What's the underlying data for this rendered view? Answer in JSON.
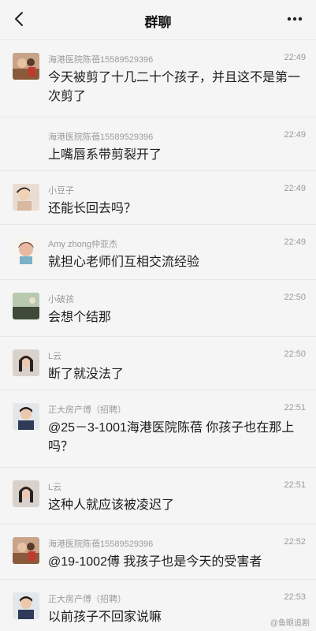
{
  "header": {
    "title": "群聊",
    "back_icon": "chevron-left-icon",
    "more_icon": "more-horizontal-icon"
  },
  "messages": [
    {
      "sender": "海港医院陈蓓15589529396",
      "time": "22:49",
      "text": "今天被剪了十几二十个孩子，并且这不是第一次剪了",
      "avatar": "group-photo-avatar"
    },
    {
      "sender": "海港医院陈蓓15589529396",
      "time": "22:49",
      "text": "上嘴唇系带剪裂开了",
      "avatar": "none"
    },
    {
      "sender": "小豆子",
      "time": "22:49",
      "text": "还能长回去吗？",
      "avatar": "child-photo-avatar"
    },
    {
      "sender": "Amy zhong仲亚杰",
      "time": "22:49",
      "text": "就担心老师们互相交流经验",
      "avatar": "cartoon-avatar"
    },
    {
      "sender": "小破孩",
      "time": "22:50",
      "text": "会想个结那",
      "avatar": "landscape-avatar"
    },
    {
      "sender": "L云",
      "time": "22:50",
      "text": "断了就没法了",
      "avatar": "portrait-avatar"
    },
    {
      "sender": "正大房产傅（招聘）",
      "time": "22:51",
      "text": "@25－3-1001海港医院陈蓓 你孩子也在那上吗？",
      "avatar": "man-photo-avatar"
    },
    {
      "sender": "L云",
      "time": "22:51",
      "text": "这种人就应该被凌迟了",
      "avatar": "portrait-avatar"
    },
    {
      "sender": "海港医院陈蓓15589529396",
      "time": "22:52",
      "text": "@19-1002傅 我孩子也是今天的受害者",
      "avatar": "group-photo-avatar"
    },
    {
      "sender": "正大房产傅（招聘）",
      "time": "22:53",
      "text": "以前孩子不回家说嘛",
      "avatar": "man-photo-avatar"
    }
  ],
  "watermark": "@鱼眼追剧"
}
